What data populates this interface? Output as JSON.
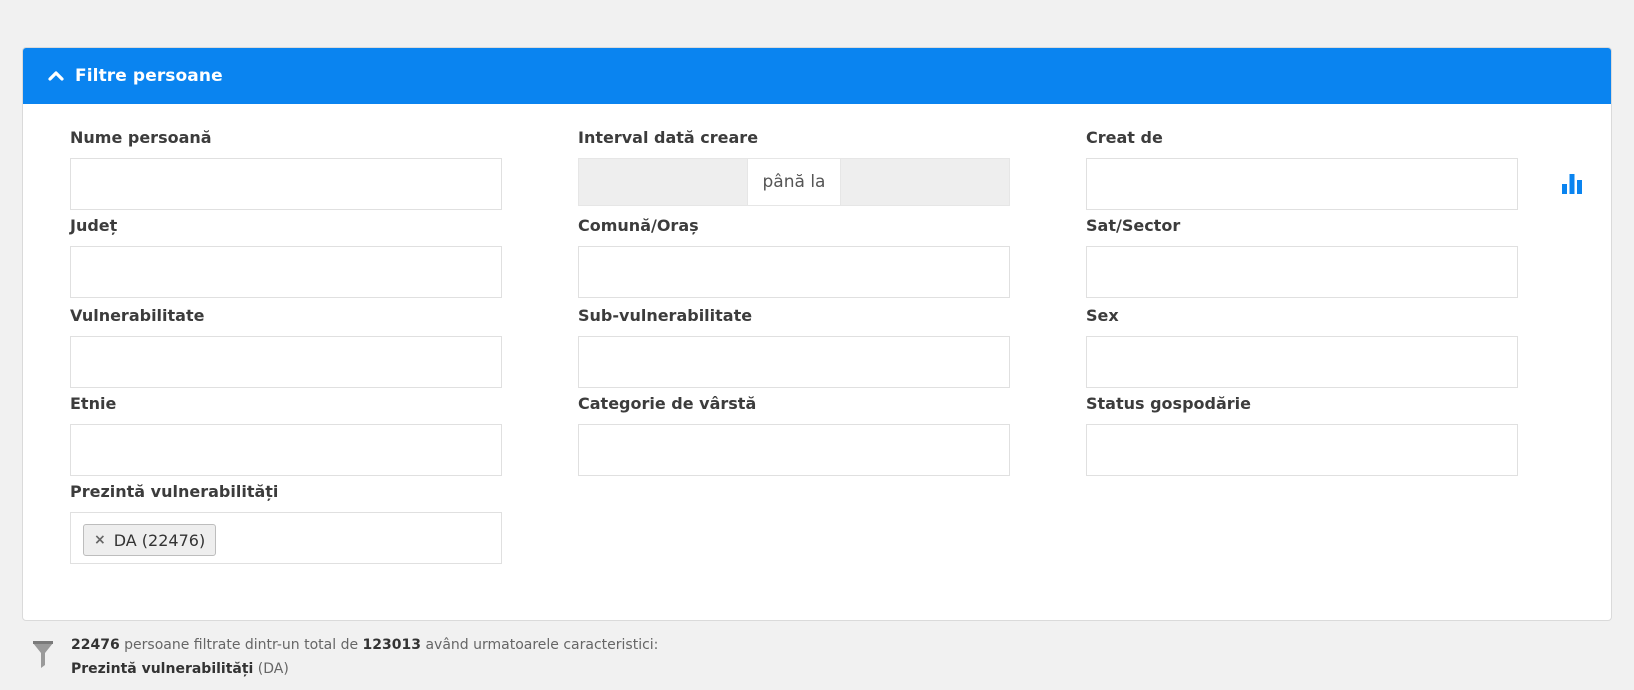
{
  "panel": {
    "title": "Filtre persoane",
    "accent_color": "#0a84f0",
    "collapse_icon": "chevron-up-icon",
    "stats_icon": "bar-chart-icon"
  },
  "fields": {
    "nume_persoana": {
      "label": "Nume persoană",
      "value": ""
    },
    "interval_data_creare": {
      "label": "Interval dată creare",
      "separator": "până la",
      "from": "",
      "to": ""
    },
    "creat_de": {
      "label": "Creat de",
      "value": ""
    },
    "judet": {
      "label": "Județ",
      "value": ""
    },
    "comuna_oras": {
      "label": "Comună/Oraș",
      "value": ""
    },
    "sat_sector": {
      "label": "Sat/Sector",
      "value": ""
    },
    "vulnerabilitate": {
      "label": "Vulnerabilitate",
      "value": ""
    },
    "sub_vulnerabilitate": {
      "label": "Sub-vulnerabilitate",
      "value": ""
    },
    "sex": {
      "label": "Sex",
      "value": ""
    },
    "etnie": {
      "label": "Etnie",
      "value": ""
    },
    "categorie_varsta": {
      "label": "Categorie de vârstă",
      "value": ""
    },
    "status_gospodarie": {
      "label": "Status gospodărie",
      "value": ""
    },
    "prezinta_vulnerabilitati": {
      "label": "Prezintă vulnerabilități",
      "tag": "DA (22476)",
      "tag_remove": "×"
    }
  },
  "summary": {
    "icon": "funnel-icon",
    "filtered_count": "22476",
    "text_a": " persoane filtrate dintr-un total de ",
    "total_count": "123013",
    "text_b": " având urmatoarele caracteristici:",
    "criteria_name": "Prezintă vulnerabilități",
    "criteria_value": " (DA)"
  }
}
